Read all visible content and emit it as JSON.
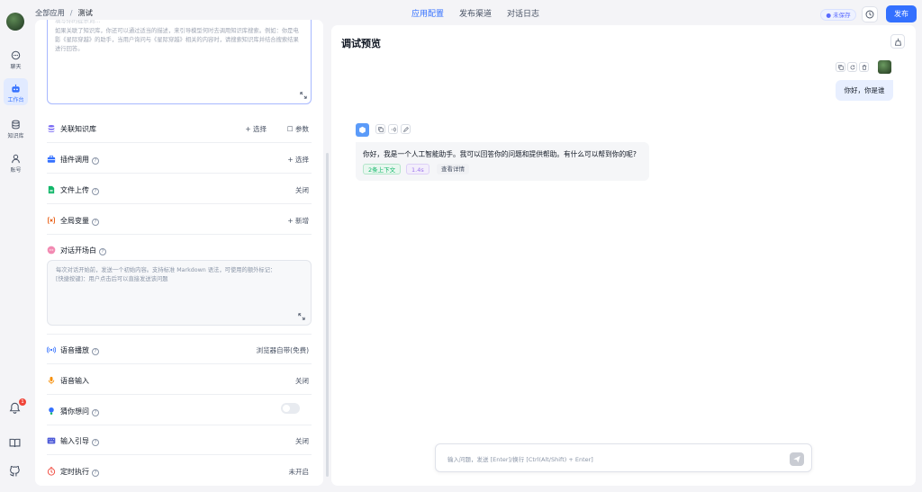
{
  "breadcrumb": {
    "root": "全部应用",
    "sep": "/",
    "current": "测试"
  },
  "tabs": [
    {
      "label": "应用配置",
      "active": true
    },
    {
      "label": "发布渠道",
      "active": false
    },
    {
      "label": "对话日志",
      "active": false
    }
  ],
  "status": {
    "unsaved": "● 未保存"
  },
  "header": {
    "publish": "发布"
  },
  "nav": {
    "items": [
      {
        "label": "聊天"
      },
      {
        "label": "工作台",
        "active": true
      },
      {
        "label": "知识库"
      },
      {
        "label": "账号"
      }
    ],
    "notification_count": "1"
  },
  "prompt": {
    "cut_text": "填写你的提示词…",
    "text": "如果关联了知识库，你还可以通过适当的描述，来引导模型何时去调用知识库搜索。例如：你是电影《星际穿越》的助手，当用户询问与《星际穿越》相关的内容时，请搜索知识库并结合搜索结果进行回答。"
  },
  "config": {
    "knowledge": {
      "title": "关联知识库",
      "select": "+ 选择",
      "params": "☐ 参数"
    },
    "plugin": {
      "title": "插件调用",
      "value": "+ 选择"
    },
    "file_upload": {
      "title": "文件上传",
      "value": "关闭"
    },
    "global_vars": {
      "title": "全局变量",
      "value": "+ 新增"
    },
    "welcome": {
      "title": "对话开场白",
      "placeholder_1": "每次对话开始前，发送一个初始内容。支持标准 Markdown 语法，可使用的额外标记：",
      "placeholder_2": "[快捷按键]：用户点击后可以直接发送该问题"
    },
    "tts": {
      "title": "语音播放",
      "value": "浏览器自带(免费)"
    },
    "voice_input": {
      "title": "语音输入",
      "value": "关闭"
    },
    "guess": {
      "title": "猜你想问",
      "enabled": false
    },
    "input_guide": {
      "title": "输入引导",
      "value": "关闭"
    },
    "scheduled": {
      "title": "定时执行",
      "value": "未开启"
    }
  },
  "preview": {
    "title": "调试预览",
    "user_message": "你好，你是谁",
    "bot_message": "你好，我是一个人工智能助手。我可以回答你的问题和提供帮助。有什么可以帮到你的呢?",
    "tags": {
      "context": "2条上下文",
      "time": "1.4s",
      "detail": "查看详情"
    },
    "input_placeholder": "输入问题，发送 [Enter]/换行 [Ctrl(Alt/Shift) + Enter]"
  },
  "colors": {
    "accent": "#3370ff",
    "unsaved": "#5a6bff",
    "context_tag": "#12b76a",
    "time_tag": "#9e77ed"
  }
}
